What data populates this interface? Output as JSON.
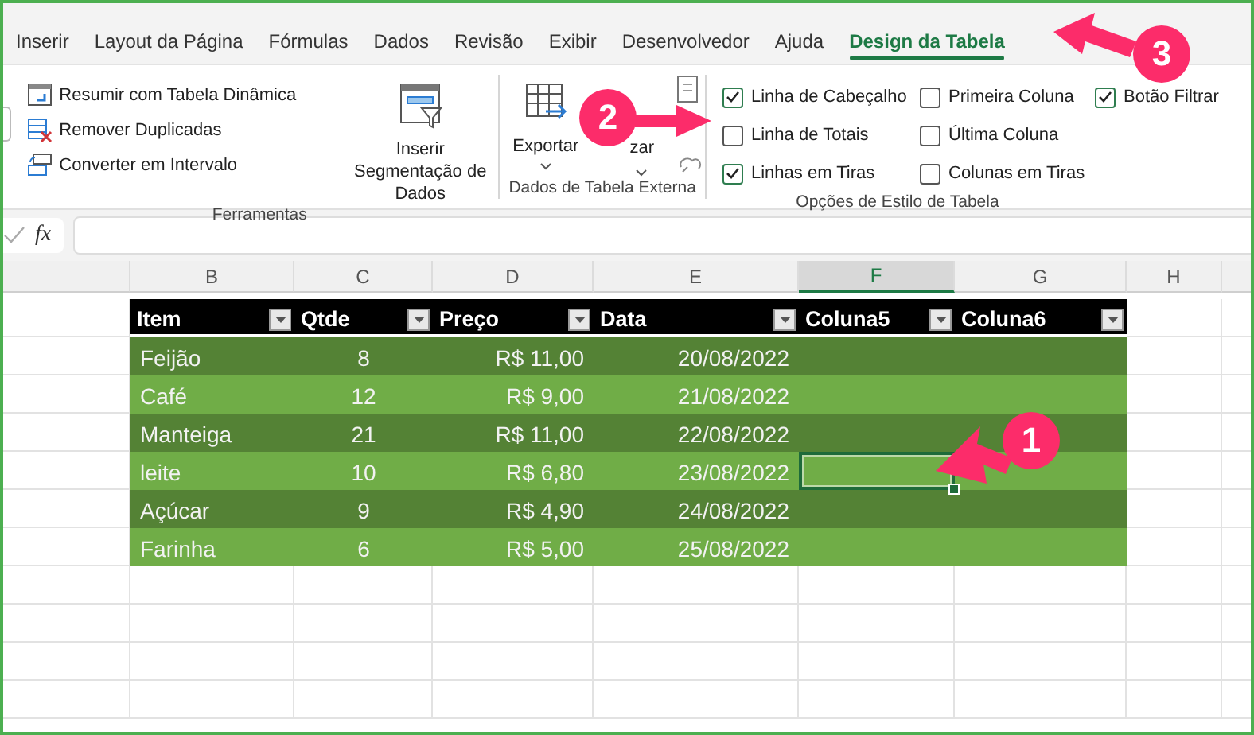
{
  "ribbon_tabs": [
    {
      "label": "Inserir",
      "selected": false
    },
    {
      "label": "Layout da Página",
      "selected": false
    },
    {
      "label": "Fórmulas",
      "selected": false
    },
    {
      "label": "Dados",
      "selected": false
    },
    {
      "label": "Revisão",
      "selected": false
    },
    {
      "label": "Exibir",
      "selected": false
    },
    {
      "label": "Desenvolvedor",
      "selected": false
    },
    {
      "label": "Ajuda",
      "selected": false
    },
    {
      "label": "Design da Tabela",
      "selected": true
    }
  ],
  "ribbon": {
    "tools": {
      "title": "Ferramentas",
      "commands": [
        "Resumir com Tabela Dinâmica",
        "Remover Duplicadas",
        "Converter em Intervalo"
      ],
      "slicer_button": "Inserir Segmentação de Dados"
    },
    "external": {
      "title": "Dados de Tabela Externa",
      "export_button": "Exportar",
      "refresh_button": "zar"
    },
    "style_options": {
      "title": "Opções de Estilo de Tabela",
      "columns": [
        [
          {
            "label": "Linha de Cabeçalho",
            "checked": true
          },
          {
            "label": "Linha de Totais",
            "checked": false
          },
          {
            "label": "Linhas em Tiras",
            "checked": true
          }
        ],
        [
          {
            "label": "Primeira Coluna",
            "checked": false
          },
          {
            "label": "Última Coluna",
            "checked": false
          },
          {
            "label": "Colunas em Tiras",
            "checked": false
          }
        ],
        [
          {
            "label": "Botão Filtrar",
            "checked": true
          }
        ]
      ]
    }
  },
  "formula_bar": {
    "function_label": "fx"
  },
  "column_headers": [
    {
      "label": "B",
      "selected": false
    },
    {
      "label": "C",
      "selected": false
    },
    {
      "label": "D",
      "selected": false
    },
    {
      "label": "E",
      "selected": false
    },
    {
      "label": "F",
      "selected": true
    },
    {
      "label": "G",
      "selected": false
    },
    {
      "label": "H",
      "selected": false
    }
  ],
  "table": {
    "columns": [
      "Item",
      "Qtde",
      "Preço",
      "Data",
      "Coluna5",
      "Coluna6"
    ],
    "rows": [
      {
        "cells": [
          "Feijão",
          "8",
          "R$ 11,00",
          "20/08/2022"
        ],
        "empty_cells": [
          {
            "selected": false
          },
          {
            "selected": false
          }
        ]
      },
      {
        "cells": [
          "Café",
          "12",
          "R$ 9,00",
          "21/08/2022"
        ],
        "empty_cells": [
          {
            "selected": false
          },
          {
            "selected": false
          }
        ]
      },
      {
        "cells": [
          "Manteiga",
          "21",
          "R$ 11,00",
          "22/08/2022"
        ],
        "empty_cells": [
          {
            "selected": false
          },
          {
            "selected": false
          }
        ]
      },
      {
        "cells": [
          "leite",
          "10",
          "R$ 6,80",
          "23/08/2022"
        ],
        "empty_cells": [
          {
            "selected": true
          },
          {
            "selected": false
          }
        ]
      },
      {
        "cells": [
          "Açúcar",
          "9",
          "R$ 4,90",
          "24/08/2022"
        ],
        "empty_cells": [
          {
            "selected": false
          },
          {
            "selected": false
          }
        ]
      },
      {
        "cells": [
          "Farinha",
          "6",
          "R$ 5,00",
          "25/08/2022"
        ],
        "empty_cells": [
          {
            "selected": false
          },
          {
            "selected": false
          }
        ]
      }
    ]
  },
  "annotations": [
    {
      "label": "1"
    },
    {
      "label": "2"
    },
    {
      "label": "3"
    }
  ]
}
